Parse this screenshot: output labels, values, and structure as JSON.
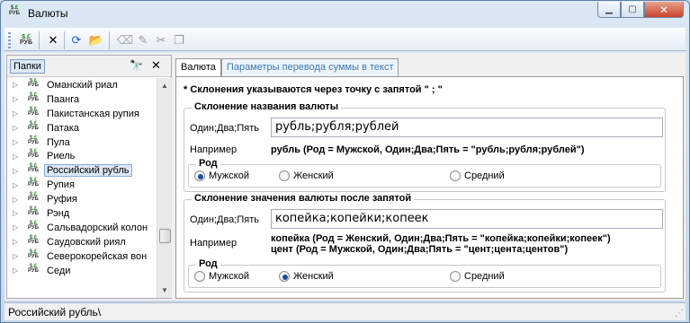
{
  "window": {
    "title": "Валюты",
    "icon_text": "$.£",
    "icon_sub": "РУБ"
  },
  "toolbar": {
    "buttons": [
      "money-icon",
      "delete-icon",
      "refresh-icon",
      "open-folder-icon",
      "eraser-icon",
      "clear-format-icon",
      "cut-icon",
      "copy-icon"
    ]
  },
  "left": {
    "tab_label": "Папки",
    "items": [
      {
        "label": "Оманский риал"
      },
      {
        "label": "Паанга"
      },
      {
        "label": "Пакистанская рупия"
      },
      {
        "label": "Патака"
      },
      {
        "label": "Пула"
      },
      {
        "label": "Риель"
      },
      {
        "label": "Российский рубль",
        "selected": true
      },
      {
        "label": "Рупия"
      },
      {
        "label": "Руфия"
      },
      {
        "label": "Рэнд"
      },
      {
        "label": "Сальвадорский колон"
      },
      {
        "label": "Саудовский риял"
      },
      {
        "label": "Северокорейская вон"
      },
      {
        "label": "Седи"
      }
    ]
  },
  "tabs": [
    {
      "label": "Валюта",
      "active": true
    },
    {
      "label": "Параметры перевода суммы в текст",
      "active": false
    }
  ],
  "content": {
    "hint": "* Склонения указываются через точку с запятой \" ; \"",
    "name_group": {
      "title": "Склонение названия валюты",
      "field_label": "Один;Два;Пять",
      "field_value": "рубль;рубля;рублей",
      "example_label": "Например",
      "example_text": "рубль (Род = Мужской, Один;Два;Пять = \"рубль;рубля;рублей\")",
      "gender_title": "Род",
      "options": [
        {
          "label": "Мужской",
          "checked": true
        },
        {
          "label": "Женский",
          "checked": false
        },
        {
          "label": "Средний",
          "checked": false
        }
      ]
    },
    "decimal_group": {
      "title": "Склонение значения валюты после запятой",
      "field_label": "Один;Два;Пять",
      "field_value": "копейка;копейки;копеек",
      "example_label": "Например",
      "example_line1": "копейка (Род = Женский, Один;Два;Пять = \"копейка;копейки;копеек\")",
      "example_line2": "цент (Род = Мужской, Один;Два;Пять = \"цент;цента;центов\")",
      "gender_title": "Род",
      "options": [
        {
          "label": "Мужской",
          "checked": false
        },
        {
          "label": "Женский",
          "checked": true
        },
        {
          "label": "Средний",
          "checked": false
        }
      ]
    }
  },
  "status": {
    "text": "Российский рубль\\"
  }
}
